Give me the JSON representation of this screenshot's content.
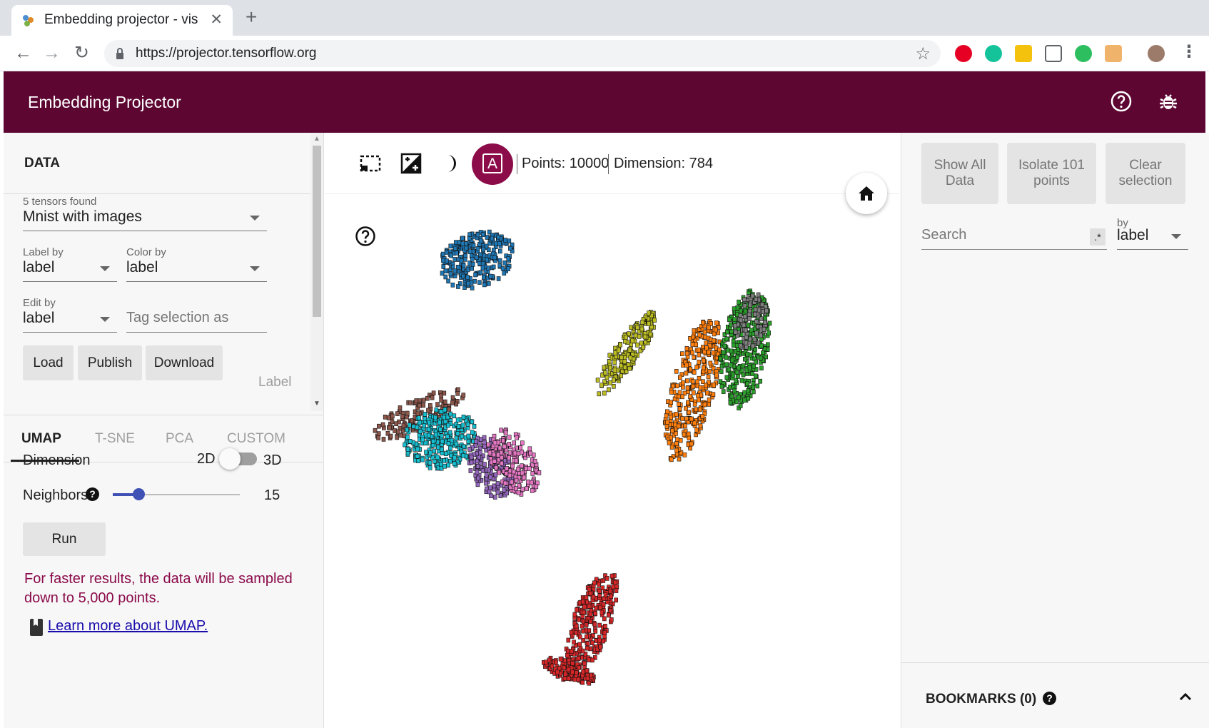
{
  "browser": {
    "tab_title": "Embedding projector - vis",
    "tab_close": "✕",
    "new_tab": "+",
    "url": "https://projector.tensorflow.org",
    "back": "←",
    "forward": "→",
    "reload": "↻",
    "star": "☆",
    "menu": "⋮",
    "extensions": [
      "pinterest-icon",
      "grammarly-icon",
      "extension-yellow-icon",
      "pocket-icon",
      "evernote-icon",
      "extension-box-icon",
      "profile-avatar"
    ]
  },
  "app": {
    "title": "Embedding Projector",
    "header_color": "#5c0631",
    "accent_color": "#8c0c4a"
  },
  "data_panel": {
    "title": "DATA",
    "tensors_found": "5 tensors found",
    "tensor_selected": "Mnist with images",
    "label_by_label": "Label by",
    "label_by_value": "label",
    "color_by_label": "Color by",
    "color_by_value": "label",
    "edit_by_label": "Edit by",
    "edit_by_value": "label",
    "tag_placeholder": "Tag selection as",
    "load": "Load",
    "publish": "Publish",
    "download": "Download",
    "label_button": "Label"
  },
  "projection_tabs": [
    "UMAP",
    "T-SNE",
    "PCA",
    "CUSTOM"
  ],
  "umap": {
    "dimension_label": "Dimension",
    "dim_2d": "2D",
    "dim_3d": "3D",
    "neighbors_label": "Neighbors",
    "neighbors_value": "15",
    "neighbors_fraction": 0.2,
    "run": "Run",
    "note": "For faster results, the data will be sampled down to 5,000 points.",
    "learn_more": "Learn more about UMAP."
  },
  "stats": {
    "points": "Points: 10000",
    "dimension": "Dimension: 784"
  },
  "right_panel": {
    "show_all": "Show All Data",
    "isolate": "Isolate 101 points",
    "clear": "Clear selection",
    "search_placeholder": "Search",
    "regex": ".*",
    "by_label": "by",
    "by_value": "label",
    "bookmarks": "BOOKMARKS (0)"
  },
  "cluster_colors": [
    "#1f77b4",
    "#ff7f0e",
    "#2ca02c",
    "#d62728",
    "#9467bd",
    "#8c564b",
    "#e377c2",
    "#7f7f7f",
    "#bcbd22",
    "#17becf"
  ]
}
